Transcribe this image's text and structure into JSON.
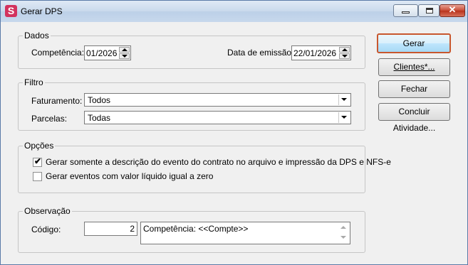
{
  "window": {
    "title": "Gerar DPS",
    "icon": "app-s-icon",
    "close_glyph": "✕"
  },
  "dados": {
    "legend": "Dados",
    "competencia_label": "Competência:",
    "competencia_value": "01/2026",
    "data_emissao_label": "Data de emissão:",
    "data_emissao_value": "22/01/2026"
  },
  "filtro": {
    "legend": "Filtro",
    "faturamento_label": "Faturamento:",
    "faturamento_value": "Todos",
    "parcelas_label": "Parcelas:",
    "parcelas_value": "Todas"
  },
  "opcoes": {
    "legend": "Opções",
    "opt1_label": "Gerar somente a descrição do evento do contrato no arquivo e impressão da DPS e NFS-e",
    "opt1_checked": true,
    "opt2_label": "Gerar eventos com valor líquido igual a zero",
    "opt2_checked": false,
    "check_glyph": "✔"
  },
  "observacao": {
    "legend": "Observação",
    "codigo_label": "Código:",
    "codigo_value": "2",
    "text": "Competência: <<Compte>>"
  },
  "buttons": {
    "gerar": "Gerar",
    "clientes": "Clientes*...",
    "fechar": "Fechar",
    "concluir": "Concluir Atividade..."
  }
}
